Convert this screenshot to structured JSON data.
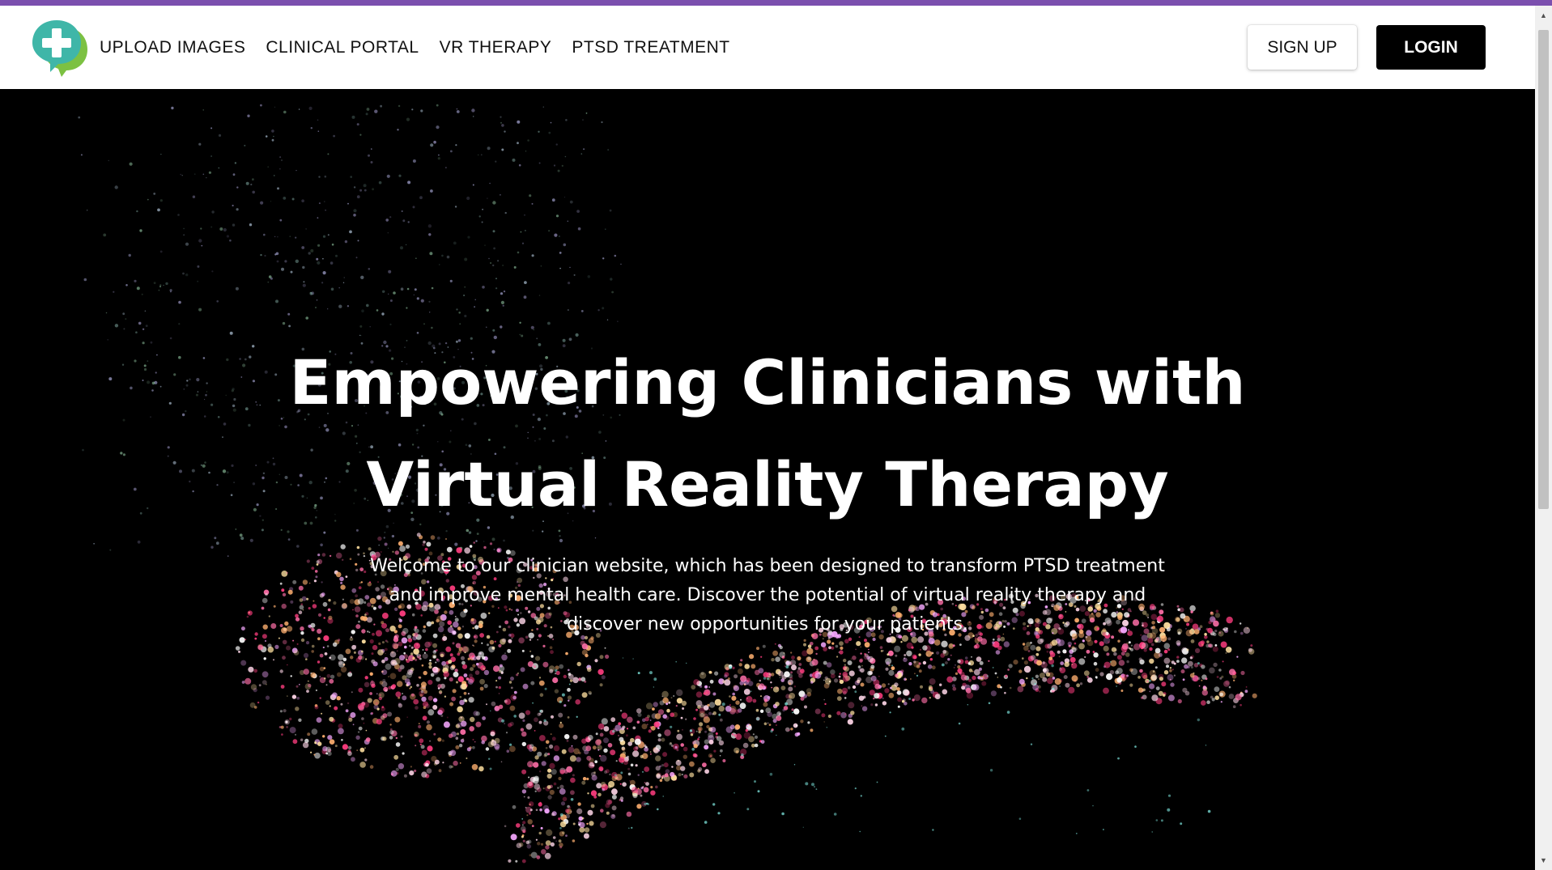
{
  "nav": {
    "logo_icon": "speech-bubble-plus-icon",
    "links": [
      "UPLOAD IMAGES",
      "CLINICAL PORTAL",
      "VR THERAPY",
      "PTSD TREATMENT"
    ],
    "signup_label": "SIGN UP",
    "login_label": "LOGIN"
  },
  "hero": {
    "title_line1": "Empowering Clinicians with",
    "title_line2": "Virtual Reality Therapy",
    "subtitle": "Welcome to our clinician website, which has been designed to transform PTSD treatment and improve mental health care. Discover the potential of virtual reality therapy and discover new opportunities for your patients.",
    "background": "particle-art-image"
  },
  "colors": {
    "accent_bar": "#7b4fae",
    "logo_teal": "#3fb6a8",
    "logo_green": "#7cc142",
    "nav_bg": "#ffffff",
    "hero_bg": "#000000",
    "login_bg": "#000000"
  }
}
